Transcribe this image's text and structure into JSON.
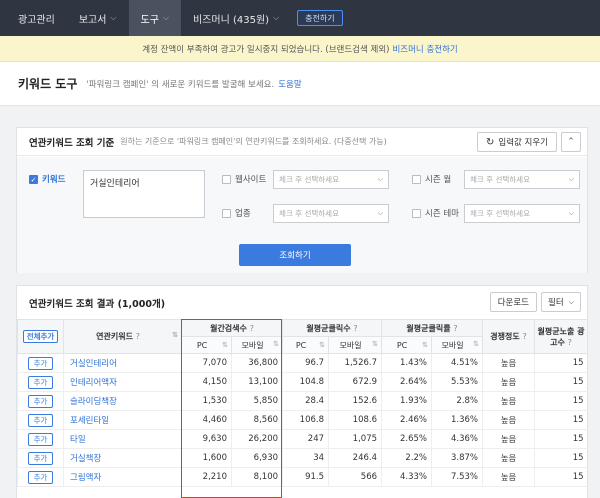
{
  "nav": {
    "items": [
      {
        "label": "광고관리",
        "chevron": false,
        "active": false
      },
      {
        "label": "보고서",
        "chevron": true,
        "active": false
      },
      {
        "label": "도구",
        "chevron": true,
        "active": true
      },
      {
        "label": "비즈머니 (435원)",
        "chevron": true,
        "active": false
      }
    ],
    "charge_label": "충전하기"
  },
  "notice": {
    "text": "계정 잔액이 부족하여 광고가 일시중지 되었습니다. (브랜드검색 제외)",
    "link": "비즈머니 충전하기"
  },
  "title": {
    "heading": "키워드 도구",
    "description": "'파워링크 캠페인' 의 새로운 키워드를 발굴해 보세요.",
    "help": "도움말"
  },
  "criteria": {
    "title": "연관키워드 조회 기준",
    "description": "원하는 기준으로 '파워링크 캠페인'의 연관키워드를 조회하세요. (다중선택 가능)",
    "reset_label": "입력값 지우기",
    "keyword_label": "키워드",
    "keyword_value": "거실인테리어",
    "website_label": "웹사이트",
    "industry_label": "업종",
    "season_month_label": "시즌 월",
    "season_theme_label": "시즌 테마",
    "select_placeholder": "체크 후 선택하세요",
    "search_label": "조회하기"
  },
  "results": {
    "title": "연관키워드 조회 결과 (1,000개)",
    "download_label": "다운로드",
    "filter_label": "필터",
    "add_all_label": "전체추가",
    "add_label": "추가",
    "headers": {
      "keyword": "연관키워드",
      "monthly_search": "월간검색수",
      "avg_clicks": "월평균클릭수",
      "avg_ctr": "월평균클릭률",
      "competition": "경쟁정도",
      "avg_ads": "월평균노출 광고수",
      "pc": "PC",
      "mobile": "모바일"
    },
    "rows": [
      {
        "keyword": "거실인테리어",
        "search_pc": "7,070",
        "search_mobile": "36,800",
        "click_pc": "96.7",
        "click_mobile": "1,526.7",
        "ctr_pc": "1.43%",
        "ctr_mobile": "4.51%",
        "competition": "높음",
        "ads": "15"
      },
      {
        "keyword": "인테리어액자",
        "search_pc": "4,150",
        "search_mobile": "13,100",
        "click_pc": "104.8",
        "click_mobile": "672.9",
        "ctr_pc": "2.64%",
        "ctr_mobile": "5.53%",
        "competition": "높음",
        "ads": "15"
      },
      {
        "keyword": "슬라이딩책장",
        "search_pc": "1,530",
        "search_mobile": "5,850",
        "click_pc": "28.4",
        "click_mobile": "152.6",
        "ctr_pc": "1.93%",
        "ctr_mobile": "2.8%",
        "competition": "높음",
        "ads": "15"
      },
      {
        "keyword": "포세린타일",
        "search_pc": "4,460",
        "search_mobile": "8,560",
        "click_pc": "106.8",
        "click_mobile": "108.6",
        "ctr_pc": "2.46%",
        "ctr_mobile": "1.36%",
        "competition": "높음",
        "ads": "15"
      },
      {
        "keyword": "타일",
        "search_pc": "9,630",
        "search_mobile": "26,200",
        "click_pc": "247",
        "click_mobile": "1,075",
        "ctr_pc": "2.65%",
        "ctr_mobile": "4.36%",
        "competition": "높음",
        "ads": "15"
      },
      {
        "keyword": "거실책장",
        "search_pc": "1,600",
        "search_mobile": "6,930",
        "click_pc": "34",
        "click_mobile": "246.4",
        "ctr_pc": "2.2%",
        "ctr_mobile": "3.87%",
        "competition": "높음",
        "ads": "15"
      },
      {
        "keyword": "그림액자",
        "search_pc": "2,210",
        "search_mobile": "8,100",
        "click_pc": "91.5",
        "click_mobile": "566",
        "ctr_pc": "4.33%",
        "ctr_mobile": "7.53%",
        "competition": "높음",
        "ads": "15"
      }
    ]
  },
  "colors": {
    "nav_bg": "#303641",
    "accent": "#3b7be0",
    "highlight_box": "#e0362e",
    "notice_bg": "#fbf5cc"
  }
}
